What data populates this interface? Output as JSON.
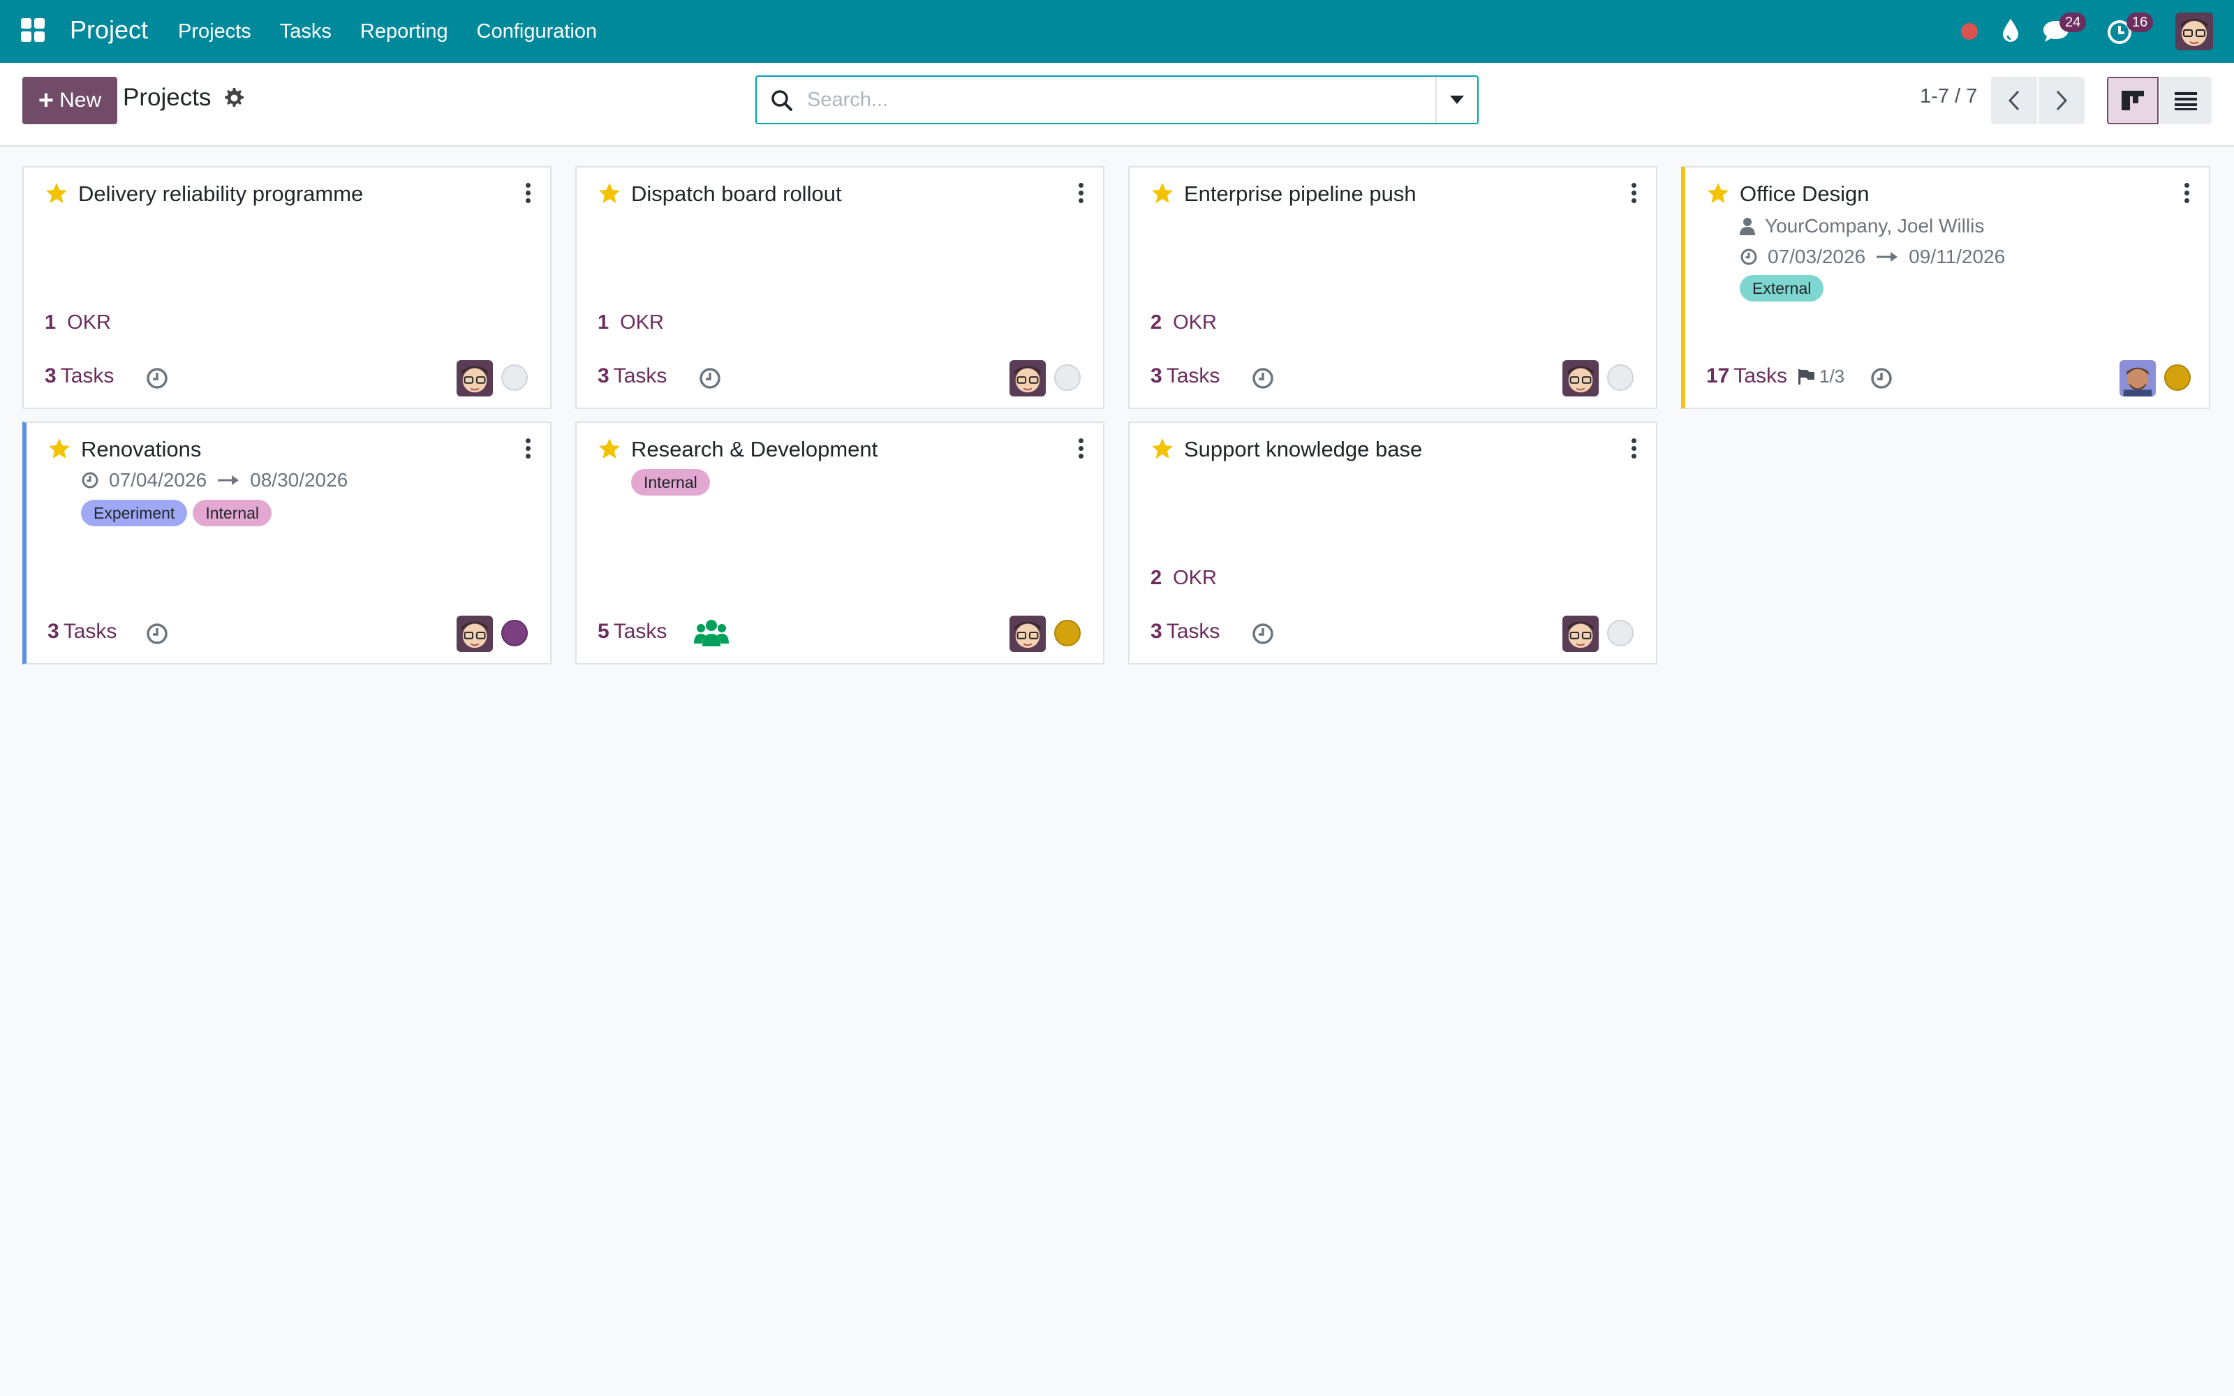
{
  "navbar": {
    "app_name": "Project",
    "menu": [
      {
        "label": "Projects"
      },
      {
        "label": "Tasks"
      },
      {
        "label": "Reporting"
      },
      {
        "label": "Configuration"
      }
    ],
    "messages_badge": "24",
    "activities_badge": "16",
    "accent_color": "#00899a"
  },
  "control_panel": {
    "new_button": "New",
    "title": "Projects",
    "search_placeholder": "Search...",
    "pager": "1-7 / 7"
  },
  "projects": [
    {
      "title": "Delivery reliability programme",
      "okr_count": "1",
      "okr_label": "OKR",
      "tasks_count": "3",
      "tasks_label": "Tasks",
      "status": "none",
      "favorite": true
    },
    {
      "title": "Dispatch board rollout",
      "okr_count": "1",
      "okr_label": "OKR",
      "tasks_count": "3",
      "tasks_label": "Tasks",
      "status": "none",
      "favorite": true
    },
    {
      "title": "Enterprise pipeline push",
      "okr_count": "2",
      "okr_label": "OKR",
      "tasks_count": "3",
      "tasks_label": "Tasks",
      "status": "none",
      "favorite": true
    },
    {
      "title": "Office Design",
      "partner": "YourCompany, Joel Willis",
      "date_start": "07/03/2026",
      "date_end": "09/11/2026",
      "tags": [
        "External"
      ],
      "tasks_count": "17",
      "tasks_label": "Tasks",
      "milestones": "1/3",
      "status": "at risk",
      "favorite": true
    },
    {
      "title": "Renovations",
      "date_start": "07/04/2026",
      "date_end": "08/30/2026",
      "tags": [
        "Experiment",
        "Internal"
      ],
      "tasks_count": "3",
      "tasks_label": "Tasks",
      "status": "done",
      "favorite": true
    },
    {
      "title": "Research & Development",
      "tags": [
        "Internal"
      ],
      "tasks_count": "5",
      "tasks_label": "Tasks",
      "status": "at risk",
      "favorite": true
    },
    {
      "title": "Support knowledge base",
      "okr_count": "2",
      "okr_label": "OKR",
      "tasks_count": "3",
      "tasks_label": "Tasks",
      "status": "none",
      "favorite": true
    }
  ],
  "colors": {
    "brand_purple": "#714b67",
    "star_yellow": "#f3c300",
    "tag_external": "#7ed6d0",
    "tag_experiment": "#9fa8f5",
    "tag_internal": "#e2a8d2"
  }
}
